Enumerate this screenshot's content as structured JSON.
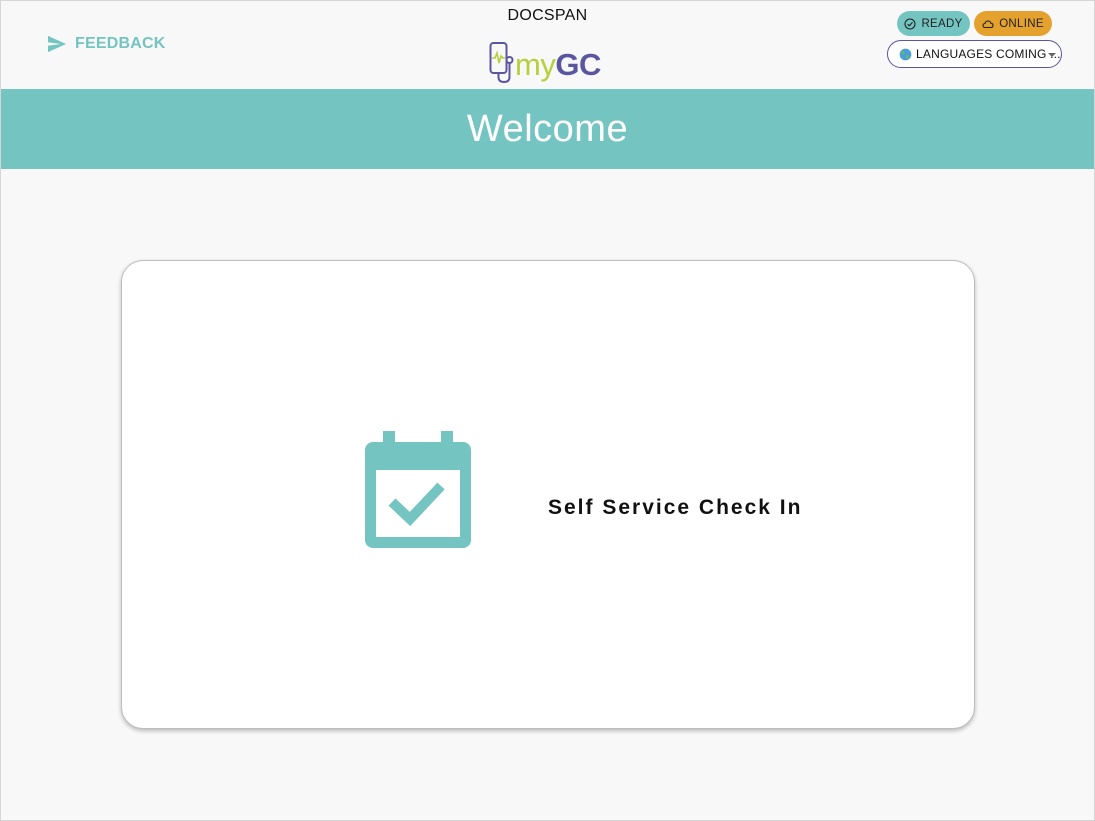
{
  "header": {
    "feedback_label": "FEEDBACK",
    "org_name": "DOCSPAN",
    "logo_my": "my",
    "logo_gc": "GC",
    "status_ready": "READY",
    "status_online": "ONLINE",
    "language_select_value": "LANGUAGES COMING ...",
    "icons": {
      "feedback": "send-icon",
      "ready": "check-circle-icon",
      "online": "cloud-icon",
      "language": "globe-icon",
      "dropdown": "chevron-down-icon"
    }
  },
  "banner": {
    "title": "Welcome"
  },
  "main": {
    "check_in_card": {
      "label": "Self Service Check In",
      "icon": "calendar-check-icon"
    }
  },
  "colors": {
    "accent_teal": "#74c5c1",
    "online_orange": "#e5a12e",
    "logo_purple": "#5a56a0",
    "logo_green": "#b7cf3a",
    "background": "#f8f8f8"
  }
}
